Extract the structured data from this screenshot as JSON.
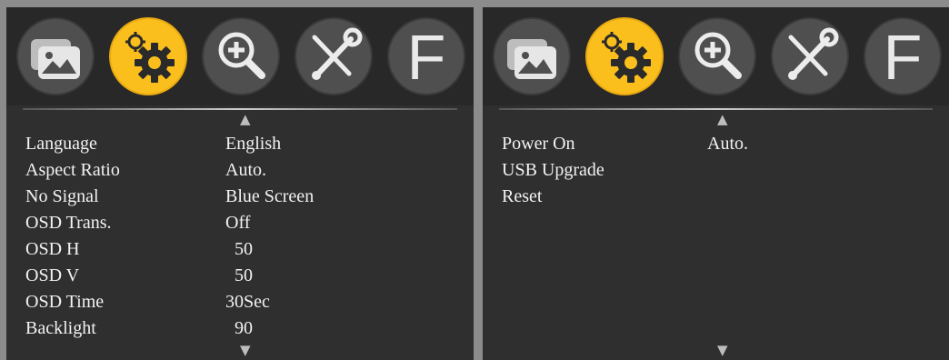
{
  "tabs_icons": [
    "picture-icon",
    "gear-icon",
    "zoom-in-icon",
    "tools-icon",
    "f-icon"
  ],
  "tab_letter": "F",
  "active_tab": "setup",
  "colors": {
    "active_tab": "#fbbf1d",
    "inactive_tab": "#4f4f4f",
    "panel_bg": "#2f2f2f",
    "text": "#f2f2f2"
  },
  "left_menu": {
    "scroll_up": "▲",
    "scroll_down": "▼",
    "items": [
      {
        "label": "Language",
        "value": "English"
      },
      {
        "label": "Aspect Ratio",
        "value": "Auto."
      },
      {
        "label": "No Signal",
        "value": "Blue Screen"
      },
      {
        "label": "OSD Trans.",
        "value": "Off"
      },
      {
        "label": "OSD H",
        "value": "50"
      },
      {
        "label": "OSD V",
        "value": "50"
      },
      {
        "label": "OSD Time",
        "value": "30Sec"
      },
      {
        "label": "Backlight",
        "value": "90"
      }
    ]
  },
  "right_menu": {
    "scroll_up": "▲",
    "scroll_down": "▼",
    "items": [
      {
        "label": "Power On",
        "value": "Auto."
      },
      {
        "label": "USB Upgrade",
        "value": ""
      },
      {
        "label": "Reset",
        "value": ""
      }
    ]
  }
}
